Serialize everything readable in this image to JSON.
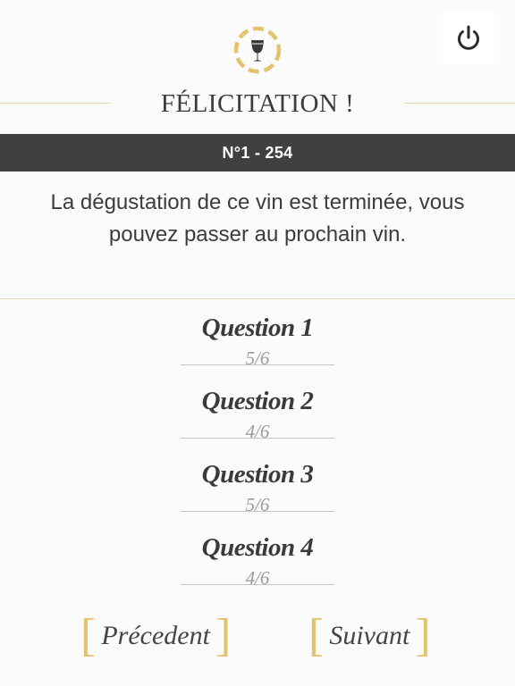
{
  "header": {
    "title": "FÉLICITATION !",
    "number": "N°1 - 254"
  },
  "message": "La dégustation de ce vin est terminée, vous pouvez passer au prochain vin.",
  "questions": [
    {
      "label": "Question 1",
      "score": "5/6"
    },
    {
      "label": "Question 2",
      "score": "4/6"
    },
    {
      "label": "Question 3",
      "score": "5/6"
    },
    {
      "label": "Question 4",
      "score": "4/6"
    }
  ],
  "nav": {
    "prev_label": "Précedent",
    "next_label": "Suivant"
  },
  "colors": {
    "accent_gold": "#e3c46c",
    "bar_dark": "#404040",
    "line_gold": "#ecd7a6"
  }
}
